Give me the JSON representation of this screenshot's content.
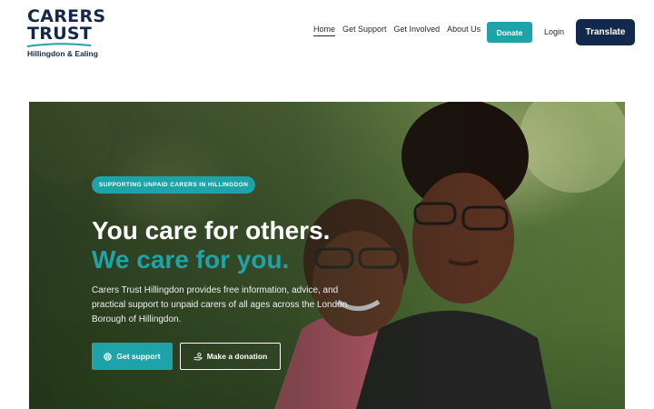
{
  "brand": {
    "logo_line1": "CARERS",
    "logo_line2": "TRUST",
    "logo_sub": "Hillingdon & Ealing",
    "colors": {
      "navy": "#13294b",
      "teal": "#1ea3a8"
    }
  },
  "nav": {
    "items": [
      {
        "label": "Home",
        "active": true
      },
      {
        "label": "Get Support",
        "active": false
      },
      {
        "label": "Get Involved",
        "active": false
      },
      {
        "label": "About Us",
        "active": false
      }
    ],
    "donate_label": "Donate",
    "login_label": "Login",
    "translate_label": "Translate"
  },
  "hero": {
    "eyebrow": "SUPPORTING UNPAID CARERS IN HILLINGDON",
    "headline_1": "You care for others.",
    "headline_2": "We care for you.",
    "intro": "Carers Trust Hillingdon provides free information, advice, and practical support to unpaid carers of all ages across the London Borough of Hillingdon.",
    "cta_primary": {
      "label": "Get support",
      "icon": "lifebuoy-icon"
    },
    "cta_secondary": {
      "label": "Make a donation",
      "icon": "donate-hand-icon"
    }
  }
}
